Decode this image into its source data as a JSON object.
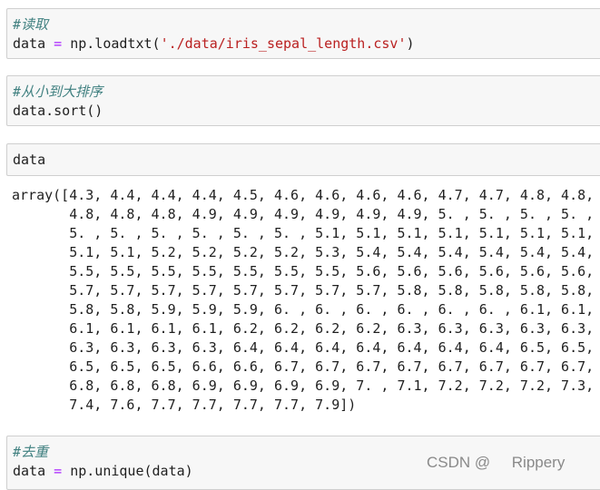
{
  "cells": [
    {
      "comment": "#读取",
      "code": {
        "var": "data",
        "op": " = ",
        "call": "np.loadtxt(",
        "arg": "'./data/iris_sepal_length.csv'",
        "close": ")"
      }
    },
    {
      "comment": "#从小到大排序",
      "code": "data.sort()"
    },
    {
      "code": "data"
    },
    {
      "comment": "#去重",
      "code": {
        "var": "data",
        "op": " = ",
        "call": "np.unique(data)"
      }
    }
  ],
  "output": {
    "lines": [
      "array([4.3, 4.4, 4.4, 4.4, 4.5, 4.6, 4.6, 4.6, 4.6, 4.7, 4.7, 4.8, 4.8,",
      "       4.8, 4.8, 4.8, 4.9, 4.9, 4.9, 4.9, 4.9, 4.9, 5. , 5. , 5. , 5. ,",
      "       5. , 5. , 5. , 5. , 5. , 5. , 5.1, 5.1, 5.1, 5.1, 5.1, 5.1, 5.1,",
      "       5.1, 5.1, 5.2, 5.2, 5.2, 5.2, 5.3, 5.4, 5.4, 5.4, 5.4, 5.4, 5.4,",
      "       5.5, 5.5, 5.5, 5.5, 5.5, 5.5, 5.5, 5.6, 5.6, 5.6, 5.6, 5.6, 5.6,",
      "       5.7, 5.7, 5.7, 5.7, 5.7, 5.7, 5.7, 5.7, 5.8, 5.8, 5.8, 5.8, 5.8,",
      "       5.8, 5.8, 5.9, 5.9, 5.9, 6. , 6. , 6. , 6. , 6. , 6. , 6.1, 6.1,",
      "       6.1, 6.1, 6.1, 6.1, 6.2, 6.2, 6.2, 6.2, 6.3, 6.3, 6.3, 6.3, 6.3,",
      "       6.3, 6.3, 6.3, 6.3, 6.4, 6.4, 6.4, 6.4, 6.4, 6.4, 6.4, 6.5, 6.5,",
      "       6.5, 6.5, 6.5, 6.6, 6.6, 6.7, 6.7, 6.7, 6.7, 6.7, 6.7, 6.7, 6.7,",
      "       6.8, 6.8, 6.8, 6.9, 6.9, 6.9, 6.9, 7. , 7.1, 7.2, 7.2, 7.2, 7.3,",
      "       7.4, 7.6, 7.7, 7.7, 7.7, 7.7, 7.9])"
    ]
  },
  "watermark": "CSDN @     Rippery",
  "colors": {
    "cell_background": "#f7f7f7",
    "cell_border": "#cfcfcf",
    "comment": "#408080",
    "operator": "#aa22ff",
    "string": "#ba2121"
  }
}
